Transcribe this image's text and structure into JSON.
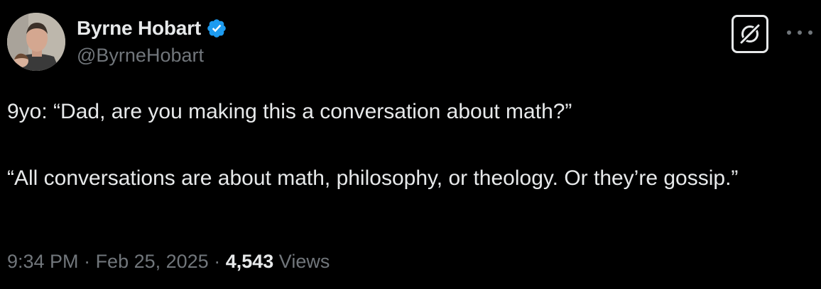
{
  "author": {
    "display_name": "Byrne Hobart",
    "handle": "@ByrneHobart",
    "verified": true,
    "verified_color": "#1d9bf0"
  },
  "actions": {
    "grok_icon": "grok-icon",
    "more_icon": "more-options-icon"
  },
  "tweet": {
    "paragraphs": [
      "9yo: “Dad, are you making this a conversation about math?”",
      "“All conversations are about math, philosophy, or theology. Or they’re gossip.”"
    ]
  },
  "meta": {
    "time": "9:34 PM",
    "separator": " · ",
    "date": "Feb 25, 2025",
    "views_count": "4,543",
    "views_label": "Views"
  },
  "colors": {
    "background": "#000000",
    "primary_text": "#e7e9ea",
    "secondary_text": "#71767b"
  }
}
